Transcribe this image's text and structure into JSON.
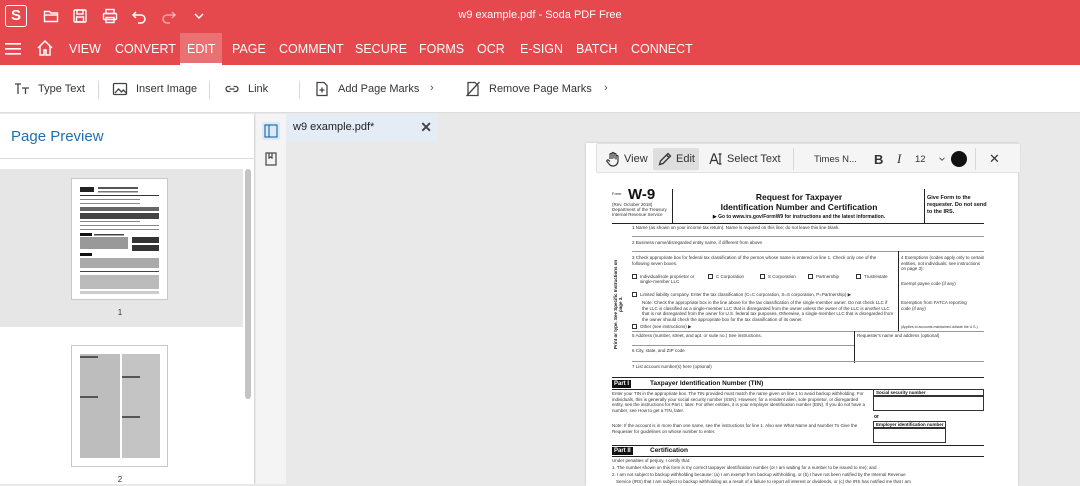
{
  "window": {
    "title": "w9 example.pdf - Soda PDF Free",
    "logo": "S"
  },
  "quick_access": [
    {
      "icon": "open-folder-icon"
    },
    {
      "icon": "save-icon"
    },
    {
      "icon": "print-icon"
    },
    {
      "icon": "undo-icon"
    },
    {
      "icon": "redo-icon"
    },
    {
      "icon": "chevron-down-icon"
    }
  ],
  "menu": {
    "items": [
      "VIEW",
      "CONVERT",
      "EDIT",
      "PAGE",
      "COMMENT",
      "SECURE",
      "FORMS",
      "OCR",
      "E-SIGN",
      "BATCH",
      "CONNECT"
    ],
    "active": "EDIT"
  },
  "ribbon": {
    "type_text": "Type Text",
    "insert_image": "Insert Image",
    "link": "Link",
    "add_page_marks": "Add Page Marks",
    "remove_page_marks": "Remove Page Marks"
  },
  "left_panel": {
    "title": "Page Preview",
    "pages": [
      "1",
      "2"
    ]
  },
  "doc_tab": {
    "label": "w9 example.pdf*",
    "close": "✕"
  },
  "edit_toolbar": {
    "view": "View",
    "edit": "Edit",
    "select_text": "Select Text",
    "font": "Times N...",
    "bold": "B",
    "italic": "I",
    "size": "12",
    "close": "✕"
  },
  "w9": {
    "form_label": "Form",
    "form_number": "W-9",
    "rev": "(Rev. October 2018)",
    "dept": "Department of the Treasury",
    "irs": "Internal Revenue Service",
    "title_line1": "Request for Taxpayer",
    "title_line2": "Identification Number and Certification",
    "goto": "▶ Go to www.irs.gov/FormW9 for instructions and the latest information.",
    "give_form": "Give Form to the requester. Do not send to the IRS.",
    "line1": "1  Name (as shown on your income tax return). Name is required on this line; do not leave this line blank.",
    "line2": "2  Business name/disregarded entity name, if different from above",
    "line3": "3  Check appropriate box for federal tax classification of the person whose name is entered on line 1. Check only one of the following seven boxes.",
    "sole": "Individual/sole proprietor or single-member LLC",
    "ccorp": "C Corporation",
    "scorp": "S Corporation",
    "partnership": "Partnership",
    "trust": "Trust/estate",
    "llc": "Limited liability company. Enter the tax classification (C=C corporation, S=S corporation, P=Partnership) ▶",
    "note": "Note: Check the appropriate box in the line above for the tax classification of the single-member owner. Do not check LLC if the LLC is classified as a single-member LLC that is disregarded from the owner unless the owner of the LLC is another LLC that is not disregarded from the owner for U.S. federal tax purposes. Otherwise, a single-member LLC that is disregarded from the owner should check the appropriate box for the tax classification of its owner.",
    "other": "Other (see instructions) ▶",
    "exemptions": "4  Exemptions (codes apply only to certain entities, not individuals; see instructions on page 3):",
    "exempt_payee": "Exempt payee code (if any)",
    "fatca": "Exemption from FATCA reporting code (if any)",
    "applies": "(Applies to accounts maintained outside the U.S.)",
    "side_text": "Print or type. See Specific Instructions on page 3.",
    "line5": "5  Address (number, street, and apt. or suite no.) See instructions.",
    "requester": "Requester's name and address (optional)",
    "line6": "6  City, state, and ZIP code",
    "line7": "7  List account number(s) here (optional)",
    "part1": "Part I",
    "part1_title": "Taxpayer Identification Number (TIN)",
    "tin_text": "Enter your TIN in the appropriate box. The TIN provided must match the name given on line 1 to avoid backup withholding. For individuals, this is generally your social security number (SSN). However, for a resident alien, sole proprietor, or disregarded entity, see the instructions for Part I, later. For other entities, it is your employer identification number (EIN). If you do not have a number, see How to get a TIN, later.",
    "tin_note": "Note: If the account is in more than one name, see the instructions for line 1. Also see What Name and Number To Give the Requester for guidelines on whose number to enter.",
    "ssn": "Social security number",
    "or": "or",
    "ein": "Employer identification number",
    "part2": "Part II",
    "part2_title": "Certification",
    "cert_intro": "Under penalties of perjury, I certify that:",
    "cert1": "1. The number shown on this form is my correct taxpayer identification number (or I am waiting for a number to be issued to me); and",
    "cert2": "2. I am not subject to backup withholding because: (a) I am exempt from backup withholding, or (b) I have not been notified by the Internal Revenue",
    "cert2b": "Service (IRS) that I am subject to backup withholding as a result of a failure to report all interest or dividends, or (c) the IRS has notified me that I am"
  },
  "colors": {
    "accent": "#e5484d",
    "link_blue": "#1f6fb2"
  }
}
